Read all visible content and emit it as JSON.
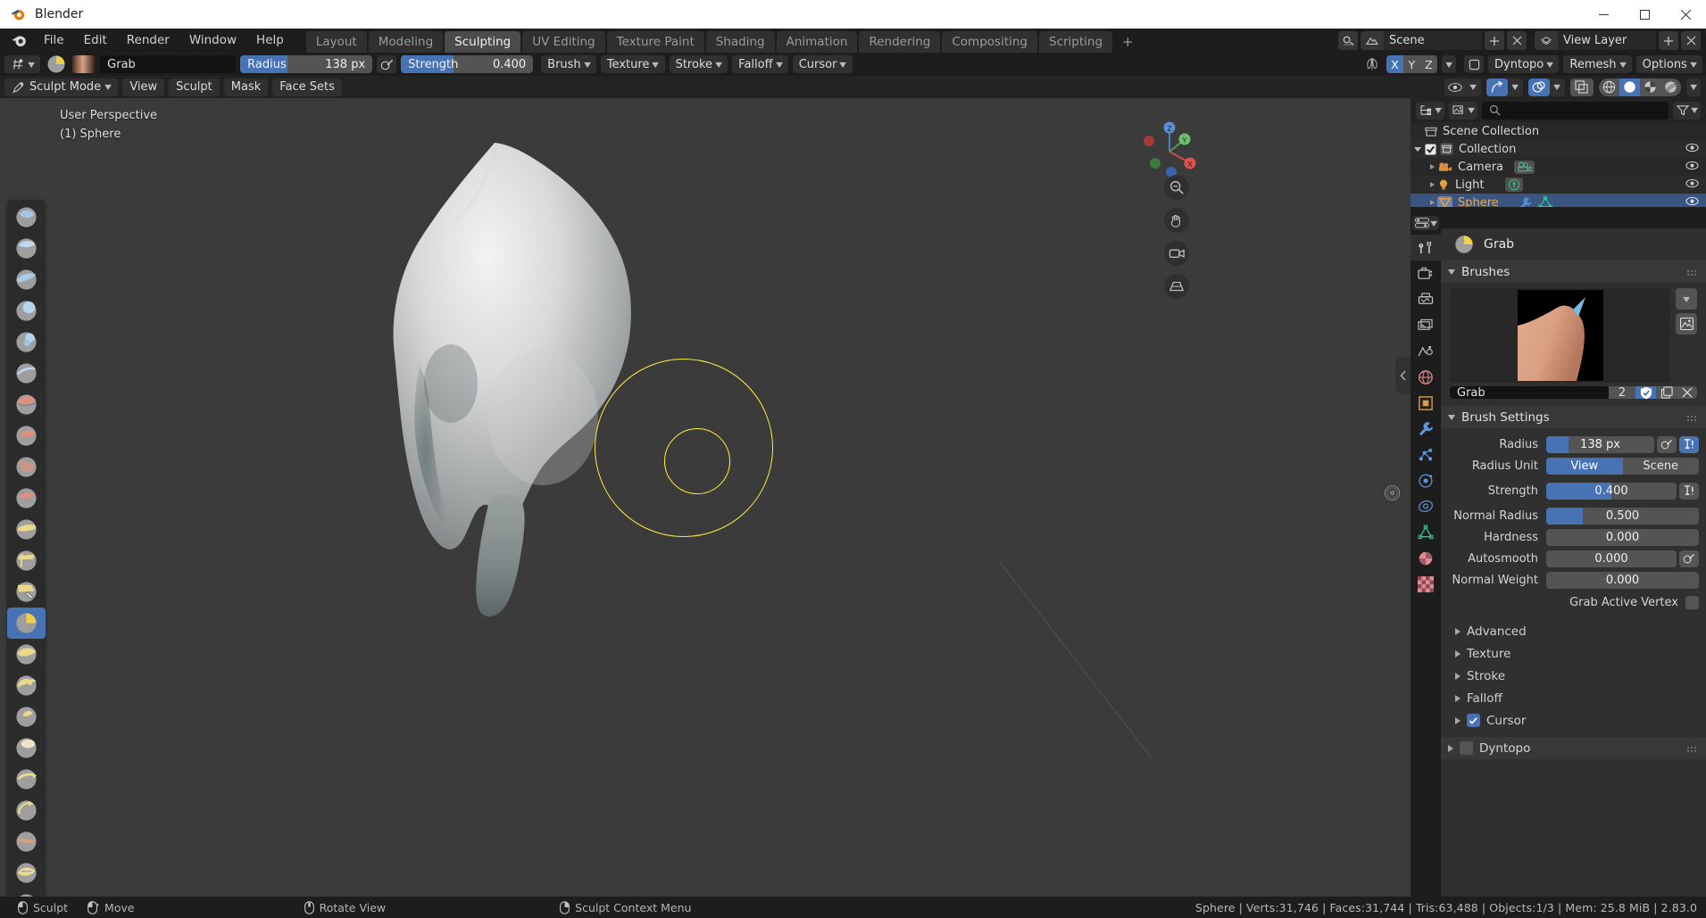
{
  "window": {
    "title": "Blender",
    "controls": {
      "minimize": "–",
      "maximize": "☐",
      "close": "✕"
    }
  },
  "menubar": {
    "items": [
      "File",
      "Edit",
      "Render",
      "Window",
      "Help"
    ],
    "workspaces": [
      {
        "label": "Layout",
        "active": false
      },
      {
        "label": "Modeling",
        "active": false
      },
      {
        "label": "Sculpting",
        "active": true
      },
      {
        "label": "UV Editing",
        "active": false
      },
      {
        "label": "Texture Paint",
        "active": false
      },
      {
        "label": "Shading",
        "active": false
      },
      {
        "label": "Animation",
        "active": false
      },
      {
        "label": "Rendering",
        "active": false
      },
      {
        "label": "Compositing",
        "active": false
      },
      {
        "label": "Scripting",
        "active": false
      }
    ],
    "add_workspace": "+",
    "scene_name": "Scene",
    "view_layer_name": "View Layer"
  },
  "toolheader": {
    "brush_name": "Grab",
    "radius_label": "Radius",
    "radius_value": "138 px",
    "radius_fill_pct": 36,
    "strength_label": "Strength",
    "strength_value": "0.400",
    "strength_fill_pct": 40,
    "menus": [
      "Brush",
      "Texture",
      "Stroke",
      "Falloff",
      "Cursor"
    ],
    "symmetry_axes": [
      {
        "label": "X",
        "on": true
      },
      {
        "label": "Y",
        "on": false
      },
      {
        "label": "Z",
        "on": false
      }
    ],
    "dyntopo_label": "Dyntopo",
    "remesh_label": "Remesh",
    "options_label": "Options"
  },
  "viewport_header": {
    "mode": "Sculpt Mode",
    "menus": [
      "View",
      "Sculpt",
      "Mask",
      "Face Sets"
    ]
  },
  "viewport": {
    "perspective_label": "User Perspective",
    "object_label": "(1) Sphere",
    "gizmo_axes": [
      "X",
      "Y",
      "Z"
    ],
    "cursor_outer_radius": 100,
    "cursor_inner_radius": 38,
    "cursor_color": "#ffef3a"
  },
  "toolbar": {
    "tools": [
      {
        "name": "draw",
        "active": false
      },
      {
        "name": "draw-sharp",
        "active": false
      },
      {
        "name": "clay",
        "active": false
      },
      {
        "name": "clay-strips",
        "active": false
      },
      {
        "name": "clay-thumb",
        "active": false
      },
      {
        "name": "layer",
        "active": false
      },
      {
        "name": "inflate",
        "active": false
      },
      {
        "name": "blob",
        "active": false
      },
      {
        "name": "crease",
        "active": false
      },
      {
        "name": "smooth",
        "active": false
      },
      {
        "name": "flatten",
        "active": false
      },
      {
        "name": "fill",
        "active": false
      },
      {
        "name": "scrape",
        "active": false
      },
      {
        "name": "multiplane-scrape",
        "active": false
      },
      {
        "name": "pinch",
        "active": false
      },
      {
        "name": "grab",
        "active": true
      },
      {
        "name": "elastic-deform",
        "active": false
      },
      {
        "name": "snake-hook",
        "active": false
      },
      {
        "name": "thumb",
        "active": false
      },
      {
        "name": "pose",
        "active": false
      },
      {
        "name": "nudge",
        "active": false
      },
      {
        "name": "rotate",
        "active": false
      },
      {
        "name": "slide-relax",
        "active": false
      }
    ]
  },
  "outliner": {
    "search_placeholder": "",
    "rows": [
      {
        "label": "Scene Collection",
        "icon": "collection-icon",
        "indent": 0,
        "selected": false,
        "eye": false,
        "checkbox": false,
        "expand": "none"
      },
      {
        "label": "Collection",
        "icon": "collection-icon",
        "indent": 1,
        "selected": false,
        "eye": true,
        "checkbox": true,
        "expand": "down"
      },
      {
        "label": "Camera",
        "icon": "camera-icon",
        "indent": 2,
        "selected": false,
        "eye": true,
        "checkbox": false,
        "expand": "right",
        "badges": [
          "camera-data-icon"
        ]
      },
      {
        "label": "Light",
        "icon": "light-icon",
        "indent": 2,
        "selected": false,
        "eye": true,
        "checkbox": false,
        "expand": "right",
        "badges": [
          "light-data-icon"
        ]
      },
      {
        "label": "Sphere",
        "icon": "mesh-object-icon",
        "indent": 2,
        "selected": true,
        "eye": true,
        "checkbox": false,
        "expand": "right",
        "badges": [
          "modifier-icon",
          "mesh-data-icon"
        ]
      }
    ]
  },
  "properties": {
    "tabs": [
      {
        "name": "tool-tab",
        "active": true
      },
      {
        "name": "render-tab",
        "active": false
      },
      {
        "name": "output-tab",
        "active": false
      },
      {
        "name": "view-layer-tab",
        "active": false
      },
      {
        "name": "scene-tab",
        "active": false
      },
      {
        "name": "world-tab",
        "active": false
      },
      {
        "name": "object-tab",
        "active": false
      },
      {
        "name": "modifier-tab",
        "active": false
      },
      {
        "name": "particles-tab",
        "active": false
      },
      {
        "name": "physics-tab",
        "active": false
      },
      {
        "name": "constraints-tab",
        "active": false
      },
      {
        "name": "object-data-tab",
        "active": false
      },
      {
        "name": "material-tab",
        "active": false
      },
      {
        "name": "texture-tab",
        "active": false
      }
    ],
    "brush_header": "Grab",
    "brushes_panel": {
      "title": "Brushes",
      "brush_name": "Grab",
      "users_count": "2",
      "fake_user_on": true
    },
    "brush_settings": {
      "title": "Brush Settings",
      "fields": [
        {
          "label": "Radius",
          "value": "138 px",
          "fill_pct": 21,
          "type": "slider",
          "buttons": [
            "pressure-icon",
            "unified-icon-on"
          ]
        },
        {
          "label": "Radius Unit",
          "type": "segment",
          "options": [
            {
              "label": "View",
              "on": true
            },
            {
              "label": "Scene",
              "on": false
            }
          ]
        },
        {
          "label": "Strength",
          "value": "0.400",
          "fill_pct": 50,
          "type": "slider",
          "buttons": [
            "unified-icon"
          ]
        },
        {
          "label": "Normal Radius",
          "value": "0.500",
          "fill_pct": 24,
          "type": "slider",
          "buttons": []
        },
        {
          "label": "Hardness",
          "value": "0.000",
          "fill_pct": 0,
          "type": "slider",
          "buttons": []
        },
        {
          "label": "Autosmooth",
          "value": "0.000",
          "fill_pct": 0,
          "type": "slider",
          "buttons": [
            "pressure-icon"
          ]
        },
        {
          "label": "Normal Weight",
          "value": "0.000",
          "fill_pct": 0,
          "type": "slider",
          "buttons": []
        }
      ],
      "checkbox_row": {
        "label": "Grab Active Vertex",
        "checked": false
      }
    },
    "subpanels": [
      {
        "label": "Advanced",
        "checkbox": null
      },
      {
        "label": "Texture",
        "checkbox": null
      },
      {
        "label": "Stroke",
        "checkbox": null
      },
      {
        "label": "Falloff",
        "checkbox": null
      },
      {
        "label": "Cursor",
        "checkbox": true
      }
    ],
    "dyntopo": {
      "label": "Dyntopo",
      "checked": false
    }
  },
  "statusbar": {
    "hints": [
      {
        "icon": "mouse-left-icon",
        "label": "Sculpt"
      },
      {
        "icon": "mouse-move-icon",
        "label": "Move"
      },
      {
        "icon": "mouse-middle-icon",
        "label": "Rotate View"
      },
      {
        "icon": "mouse-right-icon",
        "label": "Sculpt Context Menu"
      }
    ],
    "stats": "Sphere | Verts:31,746 | Faces:31,744 | Tris:63,488 | Objects:1/3 | Mem: 25.8 MiB | 2.83.0"
  },
  "colors": {
    "accent": "#4772b3",
    "selection": "#3a5680",
    "selected_text": "#f0a841",
    "cursor": "#ffef3a",
    "bg_dark": "#1d1d1d",
    "bg_panel": "#303030",
    "viewport": "#3b3b3b"
  }
}
